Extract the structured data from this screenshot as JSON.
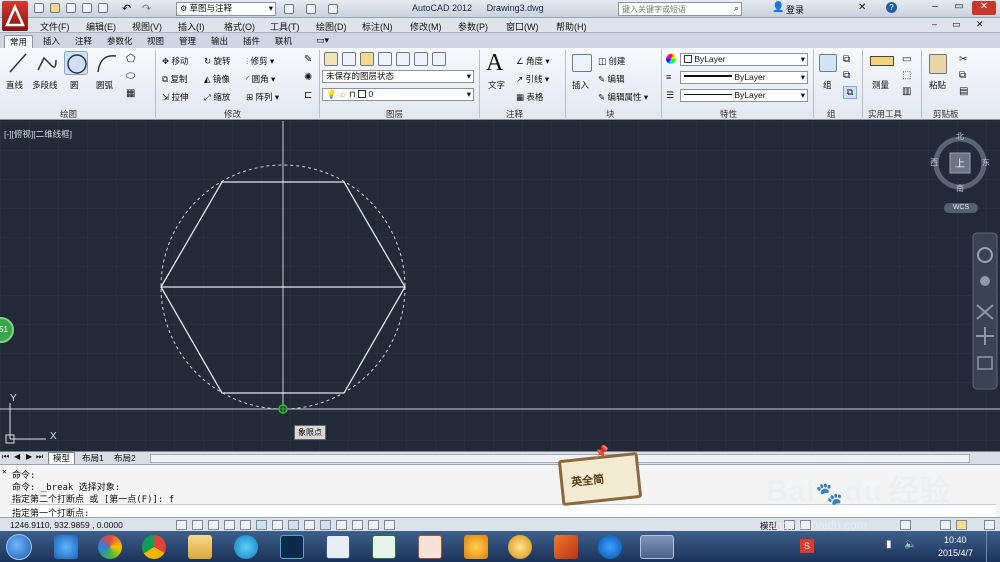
{
  "titlebar": {
    "workspace": "草图与注释",
    "app": "AutoCAD 2012",
    "file": "Drawing3.dwg",
    "search_placeholder": "键入关键字或短语",
    "login": "登录"
  },
  "menu": [
    "文件(F)",
    "编辑(E)",
    "视图(V)",
    "插入(I)",
    "格式(O)",
    "工具(T)",
    "绘图(D)",
    "标注(N)",
    "修改(M)",
    "参数(P)",
    "窗口(W)",
    "帮助(H)"
  ],
  "tabs": [
    "常用",
    "插入",
    "注释",
    "参数化",
    "视图",
    "管理",
    "输出",
    "插件",
    "联机"
  ],
  "ribbon": {
    "draw": {
      "line": "直线",
      "polyline": "多段线",
      "circle": "圆",
      "arc": "圆弧",
      "panel": "绘图"
    },
    "modify": {
      "move": "移动",
      "rotate": "旋转",
      "trim": "修剪",
      "copy": "复制",
      "mirror": "镜像",
      "fillet": "圆角",
      "stretch": "拉伸",
      "scale": "缩放",
      "array": "阵列",
      "panel": "修改"
    },
    "layers": {
      "state": "未保存的图层状态",
      "current": "0",
      "panel": "图层"
    },
    "annotation": {
      "text": "文字",
      "angle": "角度",
      "leader": "引线",
      "table": "表格",
      "panel": "注释"
    },
    "block": {
      "insert": "插入",
      "create": "创建",
      "edit": "编辑",
      "attr": "编辑属性",
      "panel": "块"
    },
    "properties": {
      "color": "ByLayer",
      "linetype": "ByLayer",
      "lineweight": "ByLayer",
      "panel": "特性"
    },
    "group": {
      "group": "组",
      "panel": "组"
    },
    "utilities": {
      "measure": "测量",
      "panel": "实用工具"
    },
    "clipboard": {
      "paste": "粘贴",
      "panel": "剪贴板"
    }
  },
  "canvas": {
    "viewlabel": "[-][俯视][二维线框]",
    "compass": {
      "n": "北",
      "s": "南",
      "e": "东",
      "w": "西",
      "top": "上"
    },
    "wcs": "WCS",
    "tooltip": "象限点",
    "ucs_x": "X",
    "ucs_y": "Y",
    "badge": "51"
  },
  "layouts": [
    "模型",
    "布局1",
    "布局2"
  ],
  "command": {
    "lines": [
      "命令:",
      "命令: _break 选择对象:",
      "指定第二个打断点 或 [第一点(F)]: f"
    ],
    "prompt": "指定第一个打断点:"
  },
  "status": {
    "coords": "1246.9110, 932.9859 , 0.0000",
    "model": "模型"
  },
  "watermark": {
    "brand": "Bai",
    "du": "du",
    "jingyan": "经验",
    "url": "jingyan.baidu.com",
    "sign": "英全简"
  },
  "clock": {
    "time": "10:40",
    "date": "2015/4/7"
  },
  "colors": {
    "canvas": "#222a37",
    "accent": "#c81e1e",
    "snap": "#27c427"
  }
}
